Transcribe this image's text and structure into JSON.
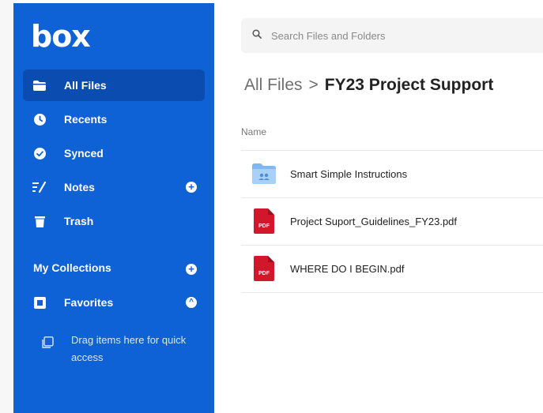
{
  "app": {
    "logo": "box"
  },
  "sidebar": {
    "items": [
      {
        "label": "All Files",
        "icon": "folder-icon",
        "active": true
      },
      {
        "label": "Recents",
        "icon": "clock-icon"
      },
      {
        "label": "Synced",
        "icon": "check-circle-icon"
      },
      {
        "label": "Notes",
        "icon": "notes-icon",
        "add": "+"
      },
      {
        "label": "Trash",
        "icon": "trash-icon"
      }
    ],
    "collections": {
      "label": "My Collections",
      "add": "+",
      "favorites": {
        "label": "Favorites",
        "icon": "star-icon",
        "toggle": "^"
      },
      "drag_hint": "Drag items here for quick access"
    }
  },
  "search": {
    "placeholder": "Search Files and Folders"
  },
  "breadcrumb": {
    "root": "All Files",
    "separator": ">",
    "current": "FY23 Project Support"
  },
  "list": {
    "column_header": "Name",
    "files": [
      {
        "name": "Smart Simple Instructions",
        "type": "folder",
        "icon": "shared-folder-icon"
      },
      {
        "name": "Project Suport_Guidelines_FY23.pdf",
        "type": "pdf",
        "badge": "PDF"
      },
      {
        "name": "WHERE DO I BEGIN.pdf",
        "type": "pdf",
        "badge": "PDF"
      }
    ]
  },
  "colors": {
    "sidebar": "#0f61d6",
    "sidebar_active": "#0a4cb0",
    "pdf_red": "#d3172a",
    "folder_blue": "#7fb8f0"
  }
}
